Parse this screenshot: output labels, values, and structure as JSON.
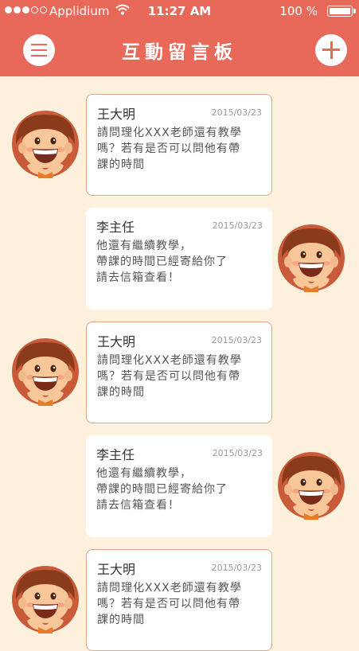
{
  "status_bar": {
    "carrier": "Applidium",
    "time": "11:27 AM",
    "battery": "100 %",
    "battery_level": 1.0
  },
  "header": {
    "title": "互動留言板"
  },
  "messages": [
    {
      "sender": "王大明",
      "date": "2015/03/23",
      "text": "請問理化XXX老師還有教學\n嗎？若有是否可以問他有帶\n課的時間",
      "avatar_side": "left"
    },
    {
      "sender": "李主任",
      "date": "2015/03/23",
      "text": "他還有繼續教學，\n帶課的時間已經寄給你了\n請去信箱查看！",
      "avatar_side": "right"
    },
    {
      "sender": "王大明",
      "date": "2015/03/23",
      "text": "請問理化XXX老師還有教學\n嗎？若有是否可以問他有帶\n課的時間",
      "avatar_side": "left"
    },
    {
      "sender": "李主任",
      "date": "2015/03/23",
      "text": "他還有繼續教學，\n帶課的時間已經寄給你了\n請去信箱查看！",
      "avatar_side": "right"
    },
    {
      "sender": "王大明",
      "date": "2015/03/23",
      "text": "請問理化XXX老師還有教學\n嗎？若有是否可以問他有帶\n課的時間",
      "avatar_side": "left"
    }
  ],
  "icons": {
    "menu": "menu-icon",
    "add": "plus-icon",
    "wifi": "wifi-icon",
    "battery": "battery-icon",
    "avatar": "cartoon-boy-avatar"
  },
  "colors": {
    "header": "#e8685a",
    "background": "#fdf0dc",
    "bubble": "#ffffff",
    "bubble_border": "#d9a98c",
    "text": "#555555",
    "date": "#9a9a9a"
  }
}
